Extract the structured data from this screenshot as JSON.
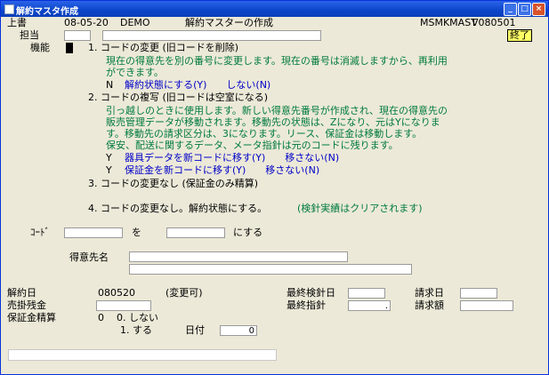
{
  "window": {
    "title": "解約マスタ作成",
    "min": "_",
    "max": "□",
    "close": "×"
  },
  "header": {
    "mode": "上書",
    "date": "08-05-20",
    "user": "DEMO",
    "screen_title": "解約マスターの作成",
    "program_id": "MSMKMAST",
    "version": "V080501",
    "exit_label": "終了"
  },
  "labels": {
    "tanto": "担当",
    "kinou": "機能",
    "opt1_title": "1. コードの変更 (旧コードを削除)",
    "opt1_desc1": "現在の得意先を別の番号に変更します。現在の番号は消滅しますから、再利用",
    "opt1_desc2": "ができます。",
    "opt1_flag": "N",
    "opt1_choice": "解約状態にする(Y)　　しない(N)",
    "opt2_title": "2. コードの複写 (旧コードは空室になる)",
    "opt2_desc1": "引っ越しのときに使用します。新しい得意先番号が作成され、現在の得意先の",
    "opt2_desc2": "販売管理データが移動されます。移動先の状態は、Zになり、元はYになりま",
    "opt2_desc3": "す。移動先の請求区分は、3になります。リース、保証金は移動します。",
    "opt2_desc4": "保安、配送に関するデータ、メータ指針は元のコードに残ります。",
    "opt2_flag1": "Y",
    "opt2_choice1": "器具データを新コードに移す(Y)　　移さない(N)",
    "opt2_flag2": "Y",
    "opt2_choice2": "保証金を新コードに移す(Y)　　移さない(N)",
    "opt3": "3. コードの変更なし (保証金のみ精算)",
    "opt4": "4. コードの変更なし。解約状態にする。",
    "opt4_note": "(検針実績はクリアされます)",
    "code": "ｺｰﾄﾞ",
    "wo": "を",
    "ni_suru": "にする",
    "customer_name": "得意先名",
    "kaiyaku_bi": "解約日",
    "kaiyaku_value": "080520",
    "henko_ka": "(変更可)",
    "saishu_kenshin_bi": "最終検針日",
    "seikyu_bi": "請求日",
    "urikake_zankin": "売掛残金",
    "saishu_shishin": "最終指針",
    "shishin_value": ".",
    "seikyu_gaku": "請求額",
    "hoshokin_seisan": "保証金精算",
    "hoshokin_value": "0",
    "shinai": "0. しない",
    "suru": "1. する",
    "hizuke": "日付",
    "hizuke_value": "0"
  },
  "colors": {
    "background": "#ece9d8",
    "green_text": "#007a3d",
    "blue_text": "#0000c8",
    "title_bar": "#0b45c9",
    "exit_button": "#ffff66"
  }
}
